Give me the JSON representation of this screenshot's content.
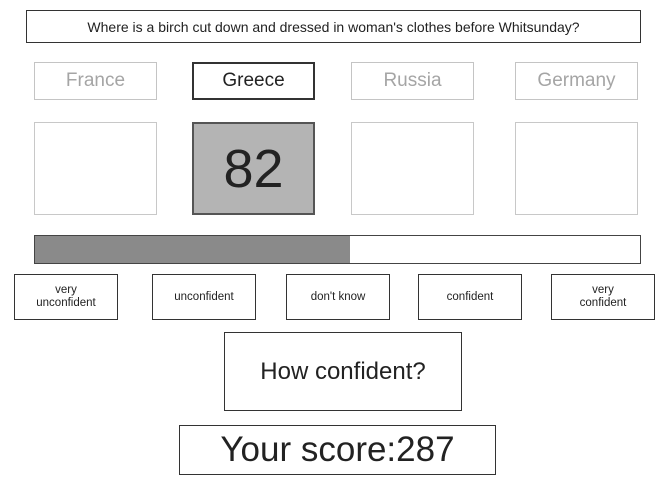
{
  "question": "Where is a birch cut down and dressed in woman's clothes before Whitsunday?",
  "options": [
    {
      "label": "France",
      "answer": "",
      "selected": false
    },
    {
      "label": "Greece",
      "answer": "82",
      "selected": true
    },
    {
      "label": "Russia",
      "answer": "",
      "selected": false
    },
    {
      "label": "Germany",
      "answer": "",
      "selected": false
    }
  ],
  "confidence_bar": {
    "fill_fraction": 0.52
  },
  "confidence_options": [
    "very\nunconfident",
    "unconfident",
    "don't know",
    "confident",
    "very\nconfident"
  ],
  "prompt": "How confident?",
  "score": {
    "label": "Your score:",
    "value": "287"
  }
}
